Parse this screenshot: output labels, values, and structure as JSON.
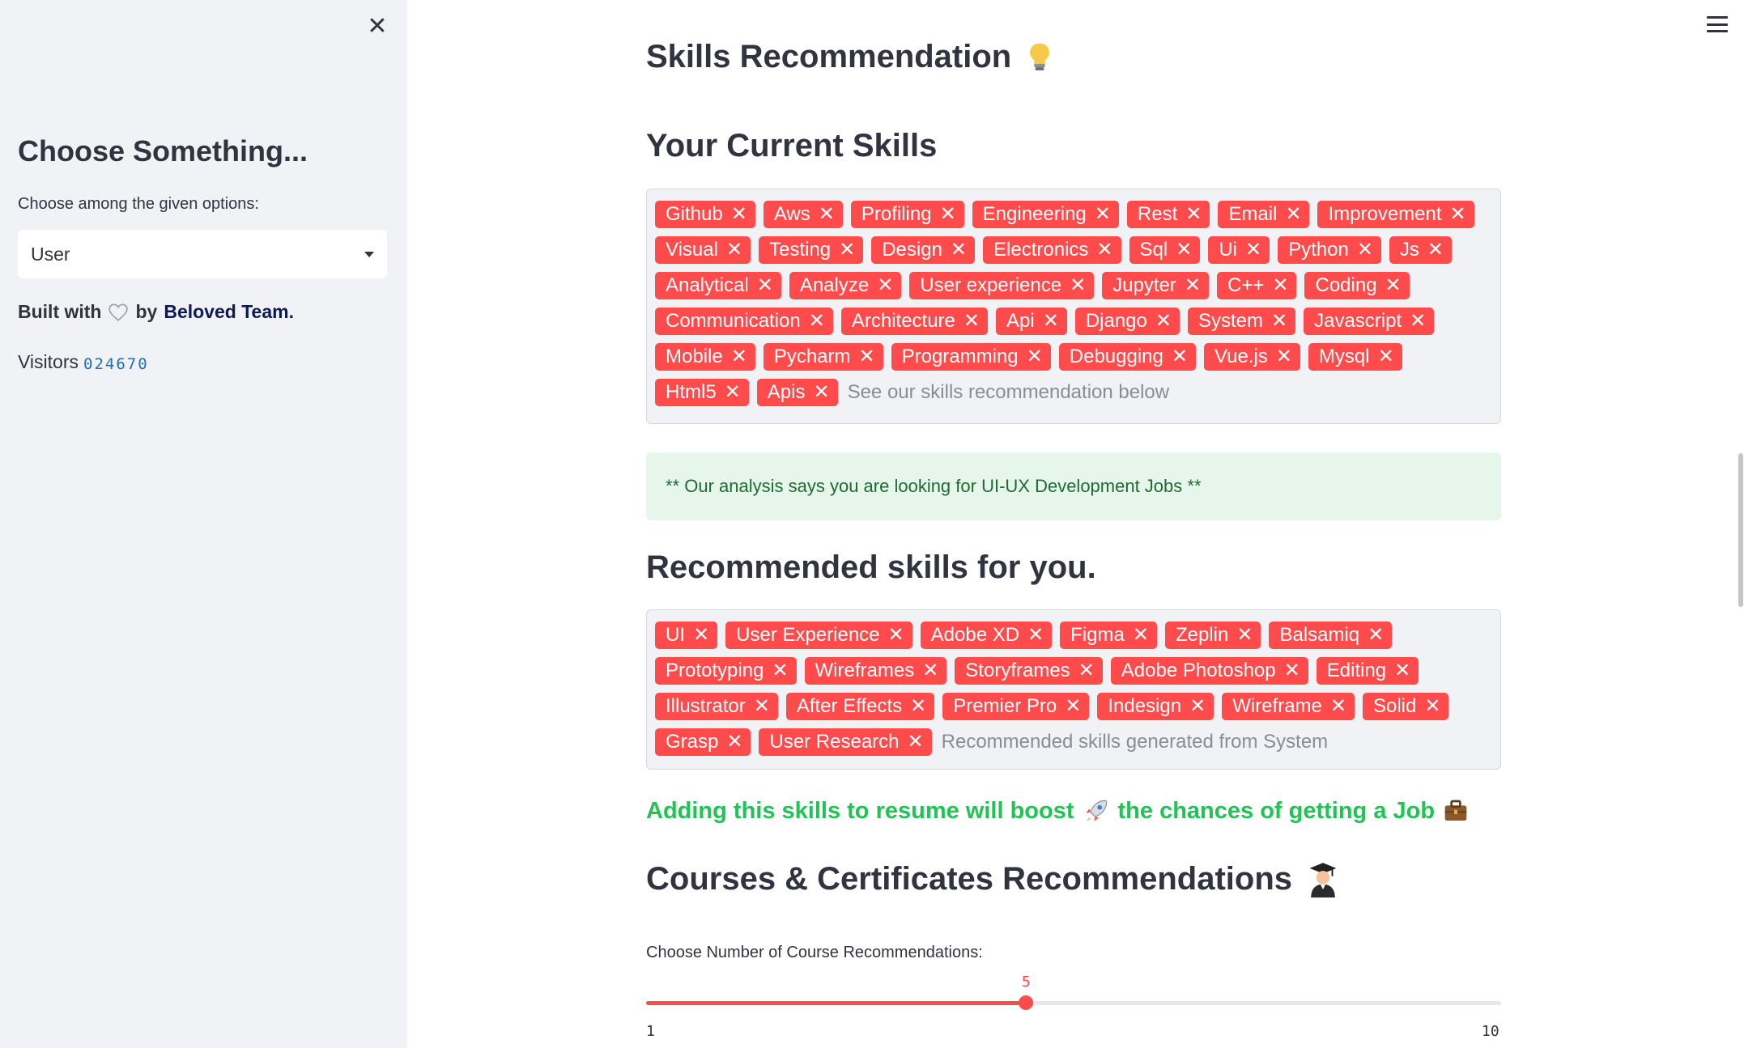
{
  "sidebar": {
    "close_icon": "close-icon",
    "title": "Choose Something...",
    "select_label": "Choose among the given options:",
    "select_value": "User",
    "built_prefix": "Built with",
    "built_by": "by",
    "team": "Beloved Team.",
    "visitors_label": "Visitors",
    "visitors_count": "024670"
  },
  "main": {
    "heading": "Skills Recommendation",
    "current_skills_title": "Your Current Skills",
    "current_skills": [
      "Github",
      "Aws",
      "Profiling",
      "Engineering",
      "Rest",
      "Email",
      "Improvement",
      "Visual",
      "Testing",
      "Design",
      "Electronics",
      "Sql",
      "Ui",
      "Python",
      "Js",
      "Analytical",
      "Analyze",
      "User experience",
      "Jupyter",
      "C++",
      "Coding",
      "Communication",
      "Architecture",
      "Api",
      "Django",
      "System",
      "Javascript",
      "Mobile",
      "Pycharm",
      "Programming",
      "Debugging",
      "Vue.js",
      "Mysql",
      "Html5",
      "Apis"
    ],
    "current_skills_placeholder": "See our skills recommendation below",
    "analysis_message": "** Our analysis says you are looking for UI-UX Development Jobs **",
    "recommended_title": "Recommended skills for you.",
    "recommended_skills": [
      "UI",
      "User Experience",
      "Adobe XD",
      "Figma",
      "Zeplin",
      "Balsamiq",
      "Prototyping",
      "Wireframes",
      "Storyframes",
      "Adobe Photoshop",
      "Editing",
      "Illustrator",
      "After Effects",
      "Premier Pro",
      "Indesign",
      "Wireframe",
      "Solid",
      "Grasp",
      "User Research"
    ],
    "recommended_placeholder": "Recommended skills generated from System",
    "boost_part1": "Adding this skills to resume will boost",
    "boost_part2": "the chances of getting a Job",
    "courses_title": "Courses & Certificates Recommendations",
    "slider": {
      "label": "Choose Number of Course Recommendations:",
      "min": 1,
      "max": 10,
      "value": 5
    }
  },
  "colors": {
    "accent": "#ff4b4b",
    "success_text": "#21c354",
    "sidebar_bg": "#f0f2f6"
  }
}
